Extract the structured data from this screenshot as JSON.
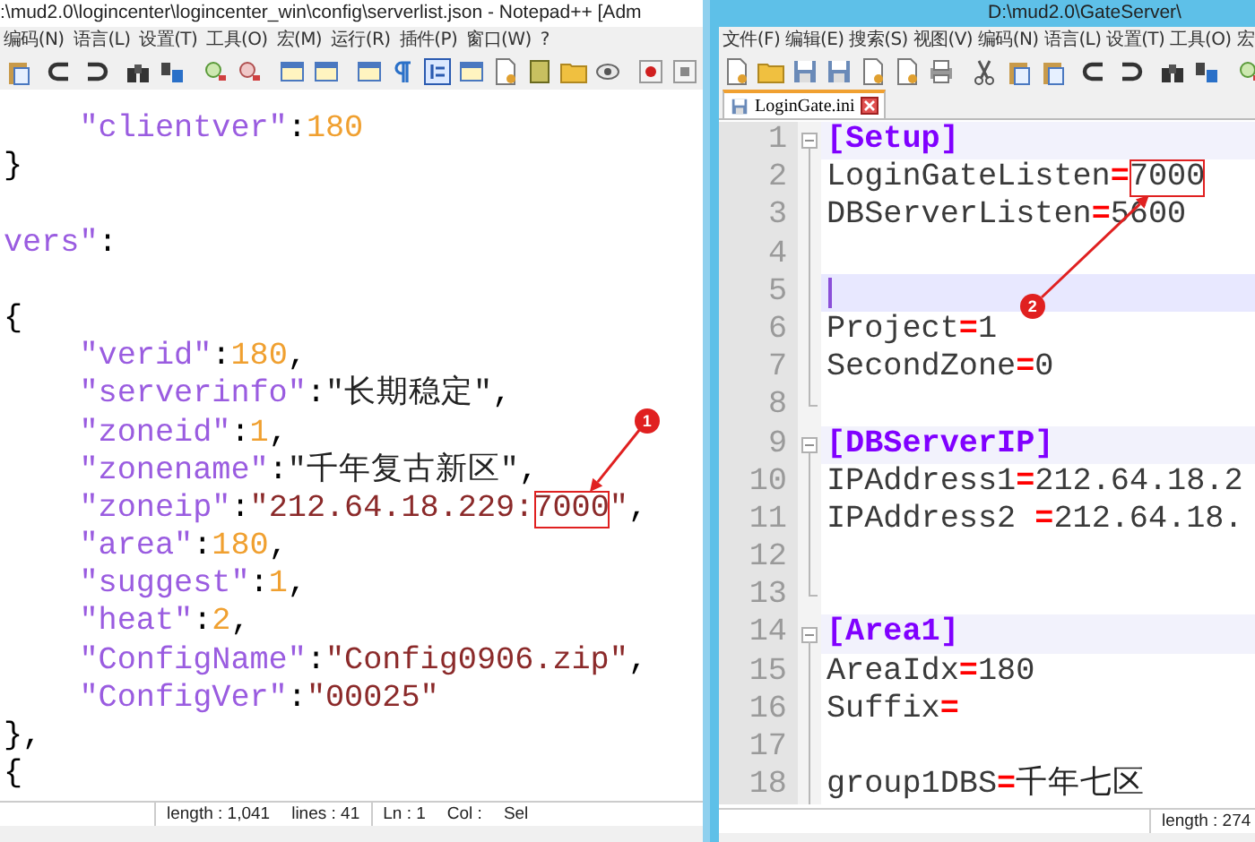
{
  "windows": [
    {
      "title": ":\\mud2.0\\logincenter\\logincenter_win\\config\\serverlist.json - Notepad++ [Adm",
      "menu": [
        "编码(N)",
        "语言(L)",
        "设置(T)",
        "工具(O)",
        "宏(M)",
        "运行(R)",
        "插件(P)",
        "窗口(W)",
        "?"
      ],
      "lines": [
        {
          "kind": "code",
          "tokens": [
            {
              "kind": "key",
              "text": "    \"clientver\""
            },
            {
              "kind": "punct",
              "text": ":"
            },
            {
              "kind": "num",
              "text": "180"
            }
          ]
        },
        {
          "kind": "code",
          "tokens": [
            {
              "kind": "punct",
              "text": "}"
            }
          ]
        },
        {
          "kind": "blank"
        },
        {
          "kind": "code",
          "tokens": [
            {
              "kind": "key",
              "text": "vers\""
            },
            {
              "kind": "punct",
              "text": ":"
            }
          ]
        },
        {
          "kind": "blank"
        },
        {
          "kind": "code",
          "tokens": [
            {
              "kind": "punct",
              "text": "{"
            }
          ]
        },
        {
          "kind": "code",
          "tokens": [
            {
              "kind": "key",
              "text": "    \"verid\""
            },
            {
              "kind": "punct",
              "text": ":"
            },
            {
              "kind": "num",
              "text": "180"
            },
            {
              "kind": "punct",
              "text": ","
            }
          ]
        },
        {
          "kind": "code",
          "tokens": [
            {
              "kind": "key",
              "text": "    \"serverinfo\""
            },
            {
              "kind": "punct",
              "text": ":"
            },
            {
              "kind": "cjk",
              "text": "\"长期稳定\""
            },
            {
              "kind": "punct",
              "text": ","
            }
          ]
        },
        {
          "kind": "code",
          "tokens": [
            {
              "kind": "key",
              "text": "    \"zoneid\""
            },
            {
              "kind": "punct",
              "text": ":"
            },
            {
              "kind": "num",
              "text": "1"
            },
            {
              "kind": "punct",
              "text": ","
            }
          ]
        },
        {
          "kind": "code",
          "tokens": [
            {
              "kind": "key",
              "text": "    \"zonename\""
            },
            {
              "kind": "punct",
              "text": ":"
            },
            {
              "kind": "cjk",
              "text": "\"千年复古新区\""
            },
            {
              "kind": "punct",
              "text": ","
            }
          ]
        },
        {
          "kind": "code",
          "tokens": [
            {
              "kind": "key",
              "text": "    \"zoneip\""
            },
            {
              "kind": "punct",
              "text": ":"
            },
            {
              "kind": "str",
              "text": "\"212.64.18.229:"
            },
            {
              "kind": "str",
              "text": "7000",
              "callout": "1"
            },
            {
              "kind": "str",
              "text": "\""
            },
            {
              "kind": "punct",
              "text": ","
            }
          ]
        },
        {
          "kind": "code",
          "tokens": [
            {
              "kind": "key",
              "text": "    \"area\""
            },
            {
              "kind": "punct",
              "text": ":"
            },
            {
              "kind": "num",
              "text": "180"
            },
            {
              "kind": "punct",
              "text": ","
            }
          ]
        },
        {
          "kind": "code",
          "tokens": [
            {
              "kind": "key",
              "text": "    \"suggest\""
            },
            {
              "kind": "punct",
              "text": ":"
            },
            {
              "kind": "num",
              "text": "1"
            },
            {
              "kind": "punct",
              "text": ","
            }
          ]
        },
        {
          "kind": "code",
          "tokens": [
            {
              "kind": "key",
              "text": "    \"heat\""
            },
            {
              "kind": "punct",
              "text": ":"
            },
            {
              "kind": "num",
              "text": "2"
            },
            {
              "kind": "punct",
              "text": ","
            }
          ]
        },
        {
          "kind": "code",
          "tokens": [
            {
              "kind": "key",
              "text": "    \"ConfigName\""
            },
            {
              "kind": "punct",
              "text": ":"
            },
            {
              "kind": "str",
              "text": "\"Config0906.zip\""
            },
            {
              "kind": "punct",
              "text": ","
            }
          ]
        },
        {
          "kind": "code",
          "tokens": [
            {
              "kind": "key",
              "text": "    \"ConfigVer\""
            },
            {
              "kind": "punct",
              "text": ":"
            },
            {
              "kind": "str",
              "text": "\"00025\""
            }
          ]
        },
        {
          "kind": "code",
          "tokens": [
            {
              "kind": "punct",
              "text": "},"
            }
          ]
        },
        {
          "kind": "code",
          "tokens": [
            {
              "kind": "punct",
              "text": "{"
            }
          ]
        }
      ],
      "status": [
        [
          "length : 1,041",
          "lines : 41"
        ],
        [
          "Ln : 1",
          "Col :",
          "Sel"
        ]
      ]
    },
    {
      "title": "D:\\mud2.0\\GateServer\\",
      "menu": [
        "文件(F)",
        "编辑(E)",
        "搜索(S)",
        "视图(V)",
        "编码(N)",
        "语言(L)",
        "设置(T)",
        "工具(O)",
        "宏"
      ],
      "tabs": [
        {
          "label": "LoginGate.ini",
          "selected": true
        }
      ],
      "lines": [
        {
          "kind": "code",
          "number": "1",
          "fold_start": true,
          "fold_end": false,
          "current": false,
          "tokens": [
            {
              "kind": "section",
              "text": "[Setup]"
            }
          ]
        },
        {
          "kind": "code",
          "number": "2",
          "fold_start": false,
          "fold_end": false,
          "current": false,
          "tokens": [
            {
              "kind": "text",
              "text": "LoginGateListen"
            },
            {
              "kind": "eq",
              "text": "="
            },
            {
              "kind": "text",
              "text": "7000",
              "callout": "2"
            }
          ]
        },
        {
          "kind": "code",
          "number": "3",
          "fold_start": false,
          "fold_end": false,
          "current": false,
          "tokens": [
            {
              "kind": "text",
              "text": "DBServerListen"
            },
            {
              "kind": "eq",
              "text": "="
            },
            {
              "kind": "text",
              "text": "5600"
            }
          ]
        },
        {
          "kind": "blank",
          "number": "4",
          "fold_start": false,
          "fold_end": false,
          "current": false
        },
        {
          "kind": "blank",
          "number": "5",
          "fold_start": false,
          "fold_end": false,
          "current": true
        },
        {
          "kind": "code",
          "number": "6",
          "fold_start": false,
          "fold_end": false,
          "current": false,
          "tokens": [
            {
              "kind": "text",
              "text": "Project"
            },
            {
              "kind": "eq",
              "text": "="
            },
            {
              "kind": "text",
              "text": "1"
            }
          ]
        },
        {
          "kind": "code",
          "number": "7",
          "fold_start": false,
          "fold_end": false,
          "current": false,
          "tokens": [
            {
              "kind": "text",
              "text": "SecondZone"
            },
            {
              "kind": "eq",
              "text": "="
            },
            {
              "kind": "text",
              "text": "0"
            }
          ]
        },
        {
          "kind": "blank",
          "number": "8",
          "fold_start": false,
          "fold_end": true,
          "current": false
        },
        {
          "kind": "code",
          "number": "9",
          "fold_start": true,
          "fold_end": false,
          "current": false,
          "tokens": [
            {
              "kind": "section",
              "text": "[DBServerIP]"
            }
          ]
        },
        {
          "kind": "code",
          "number": "10",
          "fold_start": false,
          "fold_end": false,
          "current": false,
          "tokens": [
            {
              "kind": "text",
              "text": "IPAddress1"
            },
            {
              "kind": "eq",
              "text": "="
            },
            {
              "kind": "text",
              "text": "212.64.18.2"
            }
          ]
        },
        {
          "kind": "code",
          "number": "11",
          "fold_start": false,
          "fold_end": false,
          "current": false,
          "tokens": [
            {
              "kind": "text",
              "text": "IPAddress2 "
            },
            {
              "kind": "eq",
              "text": "="
            },
            {
              "kind": "text",
              "text": "212.64.18."
            }
          ]
        },
        {
          "kind": "blank",
          "number": "12",
          "fold_start": false,
          "fold_end": false,
          "current": false
        },
        {
          "kind": "blank",
          "number": "13",
          "fold_start": false,
          "fold_end": true,
          "current": false
        },
        {
          "kind": "code",
          "number": "14",
          "fold_start": true,
          "fold_end": false,
          "current": false,
          "tokens": [
            {
              "kind": "section",
              "text": "[Area1]"
            }
          ]
        },
        {
          "kind": "code",
          "number": "15",
          "fold_start": false,
          "fold_end": false,
          "current": false,
          "tokens": [
            {
              "kind": "text",
              "text": "AreaIdx"
            },
            {
              "kind": "eq",
              "text": "="
            },
            {
              "kind": "text",
              "text": "180"
            }
          ]
        },
        {
          "kind": "code",
          "number": "16",
          "fold_start": false,
          "fold_end": false,
          "current": false,
          "tokens": [
            {
              "kind": "text",
              "text": "Suffix"
            },
            {
              "kind": "eq",
              "text": "="
            }
          ]
        },
        {
          "kind": "blank",
          "number": "17",
          "fold_start": false,
          "fold_end": false,
          "current": false
        },
        {
          "kind": "code",
          "number": "18",
          "fold_start": false,
          "fold_end": false,
          "current": false,
          "tokens": [
            {
              "kind": "text",
              "text": "group1DBS"
            },
            {
              "kind": "eq",
              "text": "="
            },
            {
              "kind": "cjk",
              "text": "千年七区"
            }
          ]
        }
      ],
      "status": [
        [
          "length : 274"
        ]
      ]
    }
  ]
}
